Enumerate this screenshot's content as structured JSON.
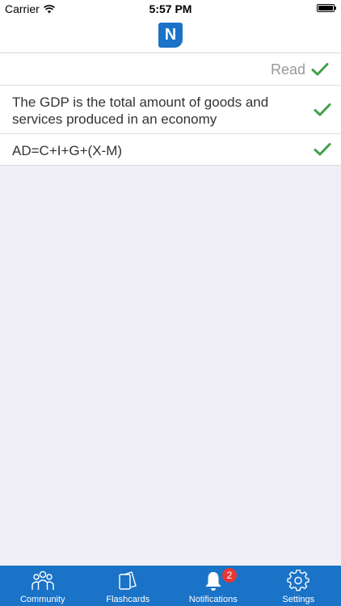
{
  "status_bar": {
    "carrier": "Carrier",
    "time": "5:57 PM",
    "battery_level": 1.0
  },
  "nav": {
    "logo_letter": "N",
    "logo_icon": "app-logo-n",
    "brand_color": "#1a73c7"
  },
  "header_row": {
    "read_label": "Read",
    "check_icon": "checkmark-icon",
    "check_color": "#43a047"
  },
  "items": [
    {
      "text": "The GDP is the total amount of goods and services produced in an economy",
      "read": true
    },
    {
      "text": "AD=C+I+G+(X-M)",
      "read": true
    }
  ],
  "tab_bar": {
    "background": "#1a73c7",
    "tabs": [
      {
        "label": "Community",
        "icon": "people-icon"
      },
      {
        "label": "Flashcards",
        "icon": "cards-icon"
      },
      {
        "label": "Notifications",
        "icon": "bell-icon",
        "badge": "2"
      },
      {
        "label": "Settings",
        "icon": "gear-icon"
      }
    ]
  }
}
